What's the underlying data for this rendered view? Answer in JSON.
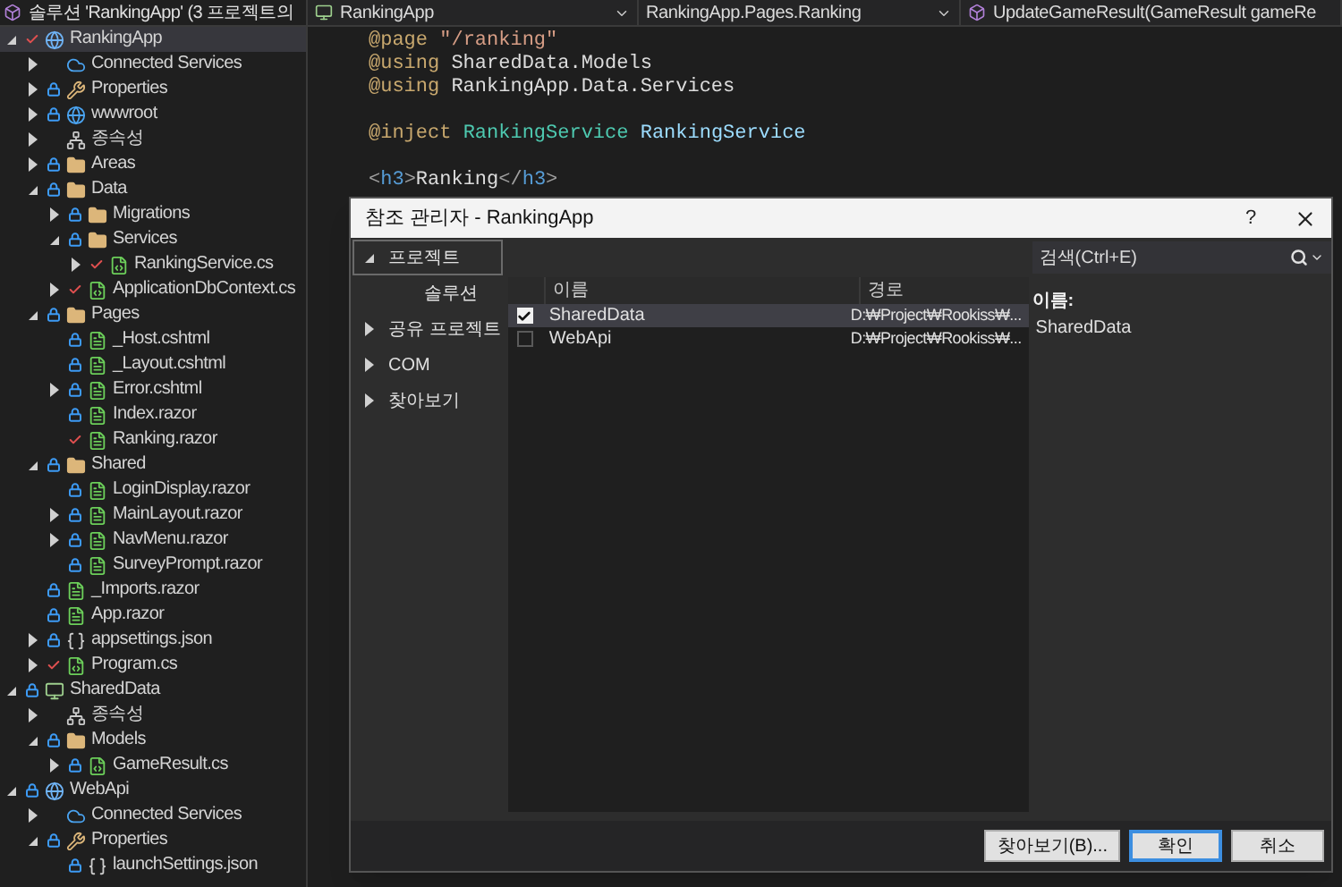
{
  "explorer": {
    "title": "솔루션 'RankingApp' (3 프로젝트의",
    "tree": [
      {
        "label": "RankingApp",
        "kind": "web-project",
        "expanded": true,
        "locked": false,
        "pending_edit": true,
        "selected": true,
        "children": [
          {
            "label": "Connected Services",
            "kind": "connected",
            "expanded": false,
            "locked": false,
            "pending_edit": false,
            "selected": false
          },
          {
            "label": "Properties",
            "kind": "properties",
            "expanded": false,
            "locked": true,
            "pending_edit": false,
            "selected": false
          },
          {
            "label": "wwwroot",
            "kind": "globe",
            "expanded": false,
            "locked": true,
            "pending_edit": false,
            "selected": false
          },
          {
            "label": "종속성",
            "kind": "dependencies",
            "expanded": false,
            "locked": false,
            "pending_edit": false,
            "selected": false
          },
          {
            "label": "Areas",
            "kind": "folder",
            "expanded": false,
            "locked": true,
            "pending_edit": false,
            "selected": false
          },
          {
            "label": "Data",
            "kind": "folder",
            "expanded": true,
            "locked": true,
            "pending_edit": false,
            "selected": false,
            "children": [
              {
                "label": "Migrations",
                "kind": "folder",
                "expanded": false,
                "locked": true,
                "pending_edit": false,
                "selected": false
              },
              {
                "label": "Services",
                "kind": "folder",
                "expanded": true,
                "locked": true,
                "pending_edit": false,
                "selected": false,
                "children": [
                  {
                    "label": "RankingService.cs",
                    "kind": "csharp",
                    "expanded": false,
                    "locked": false,
                    "pending_edit": true,
                    "selected": false
                  }
                ]
              },
              {
                "label": "ApplicationDbContext.cs",
                "kind": "csharp",
                "expanded": false,
                "locked": false,
                "pending_edit": true,
                "selected": false
              }
            ]
          },
          {
            "label": "Pages",
            "kind": "folder",
            "expanded": true,
            "locked": true,
            "pending_edit": false,
            "selected": false,
            "children": [
              {
                "label": "_Host.cshtml",
                "kind": "razor",
                "locked": true,
                "pending_edit": false,
                "selected": false
              },
              {
                "label": "_Layout.cshtml",
                "kind": "razor",
                "locked": true,
                "pending_edit": false,
                "selected": false
              },
              {
                "label": "Error.cshtml",
                "kind": "razor",
                "expanded": false,
                "locked": true,
                "pending_edit": false,
                "selected": false
              },
              {
                "label": "Index.razor",
                "kind": "razor",
                "locked": true,
                "pending_edit": false,
                "selected": false
              },
              {
                "label": "Ranking.razor",
                "kind": "razor",
                "locked": false,
                "pending_edit": true,
                "selected": false
              }
            ]
          },
          {
            "label": "Shared",
            "kind": "folder",
            "expanded": true,
            "locked": true,
            "pending_edit": false,
            "selected": false,
            "children": [
              {
                "label": "LoginDisplay.razor",
                "kind": "razor",
                "locked": true,
                "pending_edit": false,
                "selected": false
              },
              {
                "label": "MainLayout.razor",
                "kind": "razor",
                "expanded": false,
                "locked": true,
                "pending_edit": false,
                "selected": false
              },
              {
                "label": "NavMenu.razor",
                "kind": "razor",
                "expanded": false,
                "locked": true,
                "pending_edit": false,
                "selected": false
              },
              {
                "label": "SurveyPrompt.razor",
                "kind": "razor",
                "locked": true,
                "pending_edit": false,
                "selected": false
              }
            ]
          },
          {
            "label": "_Imports.razor",
            "kind": "razor",
            "locked": true,
            "pending_edit": false,
            "selected": false
          },
          {
            "label": "App.razor",
            "kind": "razor",
            "locked": true,
            "pending_edit": false,
            "selected": false
          },
          {
            "label": "appsettings.json",
            "kind": "json",
            "expanded": false,
            "locked": true,
            "pending_edit": false,
            "selected": false
          },
          {
            "label": "Program.cs",
            "kind": "csharp",
            "expanded": false,
            "locked": false,
            "pending_edit": true,
            "selected": false
          }
        ]
      },
      {
        "label": "SharedData",
        "kind": "library-project",
        "expanded": true,
        "locked": true,
        "pending_edit": false,
        "selected": false,
        "children": [
          {
            "label": "종속성",
            "kind": "dependencies",
            "expanded": false,
            "locked": false,
            "pending_edit": false,
            "selected": false
          },
          {
            "label": "Models",
            "kind": "folder",
            "expanded": true,
            "locked": true,
            "pending_edit": false,
            "selected": false,
            "children": [
              {
                "label": "GameResult.cs",
                "kind": "csharp",
                "expanded": false,
                "locked": true,
                "pending_edit": false,
                "selected": false
              }
            ]
          }
        ]
      },
      {
        "label": "WebApi",
        "kind": "web-project",
        "expanded": true,
        "locked": true,
        "pending_edit": false,
        "selected": false,
        "children": [
          {
            "label": "Connected Services",
            "kind": "connected",
            "expanded": false,
            "locked": false,
            "pending_edit": false,
            "selected": false
          },
          {
            "label": "Properties",
            "kind": "properties",
            "expanded": true,
            "locked": true,
            "pending_edit": false,
            "selected": false,
            "children": [
              {
                "label": "launchSettings.json",
                "kind": "json",
                "locked": true,
                "pending_edit": false,
                "selected": false
              }
            ]
          }
        ]
      }
    ]
  },
  "navbar": [
    {
      "label": "RankingApp",
      "kind": "project"
    },
    {
      "label": "RankingApp.Pages.Ranking",
      "kind": "plain"
    },
    {
      "label": "UpdateGameResult(GameResult gameRe",
      "kind": "method"
    }
  ],
  "code": {
    "blocks": [
      [
        [
          {
            "text": "@page",
            "kind": "directive"
          },
          {
            "text": " \"/ranking\"",
            "kind": "string"
          }
        ],
        [
          {
            "text": "@using",
            "kind": "directive"
          },
          {
            "text": " SharedData.Models",
            "kind": "text"
          }
        ],
        [
          {
            "text": "@using",
            "kind": "directive"
          },
          {
            "text": " RankingApp.Data.Services",
            "kind": "text"
          }
        ]
      ],
      [
        [
          {
            "text": "@inject",
            "kind": "directive"
          },
          {
            "text": " RankingService",
            "kind": "type"
          },
          {
            "text": " RankingService",
            "kind": "member"
          }
        ]
      ],
      [
        [
          {
            "text": "<",
            "kind": "punct"
          },
          {
            "text": "h3",
            "kind": "tag"
          },
          {
            "text": ">",
            "kind": "punct"
          },
          {
            "text": "Ranking",
            "kind": "text"
          },
          {
            "text": "</",
            "kind": "punct"
          },
          {
            "text": "h3",
            "kind": "tag"
          },
          {
            "text": ">",
            "kind": "punct"
          }
        ]
      ]
    ]
  },
  "dialog": {
    "title": "참조 관리자 - RankingApp",
    "help": "?",
    "nav": [
      {
        "label": "프로젝트",
        "expanded": true,
        "selected": true,
        "children": [
          {
            "label": "솔루션",
            "selected": false
          }
        ]
      },
      {
        "label": "공유 프로젝트",
        "expanded": false,
        "selected": false
      },
      {
        "label": "COM",
        "expanded": false,
        "selected": false
      },
      {
        "label": "찾아보기",
        "expanded": false,
        "selected": false
      }
    ],
    "search": {
      "placeholder": "검색(Ctrl+E)"
    },
    "columns": [
      "이름",
      "경로"
    ],
    "rows": [
      {
        "checked": true,
        "selected": true,
        "name": "SharedData",
        "path": "D:₩Project₩Rookiss₩..."
      },
      {
        "checked": false,
        "selected": false,
        "name": "WebApi",
        "path": "D:₩Project₩Rookiss₩..."
      }
    ],
    "details": {
      "label": "이름:",
      "value": "SharedData"
    },
    "buttons": [
      {
        "label": "찾아보기(B)...",
        "default": false
      },
      {
        "label": "확인",
        "default": true
      },
      {
        "label": "취소",
        "default": false
      }
    ]
  }
}
